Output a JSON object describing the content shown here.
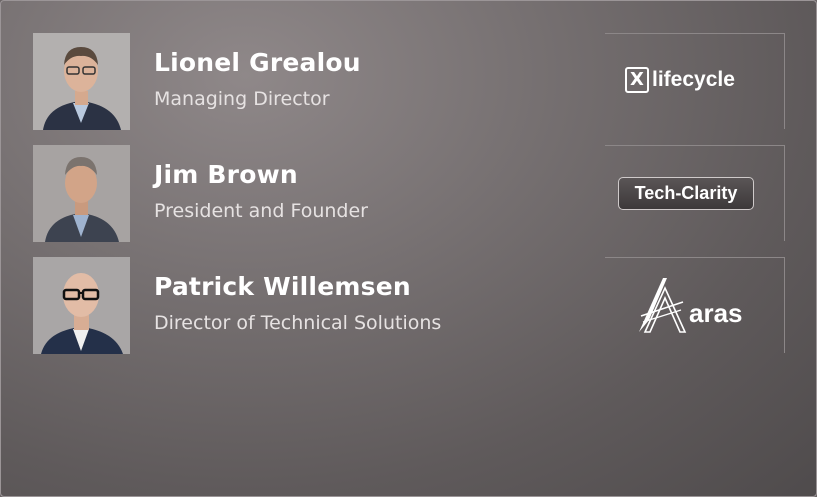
{
  "people": [
    {
      "name": "Lionel Grealou",
      "role": "Managing Director",
      "logo_icon": "lifecycle-logo-icon",
      "logo_text": "lifecycle",
      "logo_mark": "X"
    },
    {
      "name": "Jim Brown",
      "role": "President and Founder",
      "logo_icon": "tech-clarity-logo",
      "logo_text": "Tech-Clarity"
    },
    {
      "name": "Patrick Willemsen",
      "role": "Director of Technical Solutions",
      "logo_icon": "aras-logo-icon",
      "logo_text": "aras"
    }
  ],
  "colors": {
    "text": "#ffffff",
    "subtext": "#e6e2e2",
    "background": "#6b6566"
  }
}
